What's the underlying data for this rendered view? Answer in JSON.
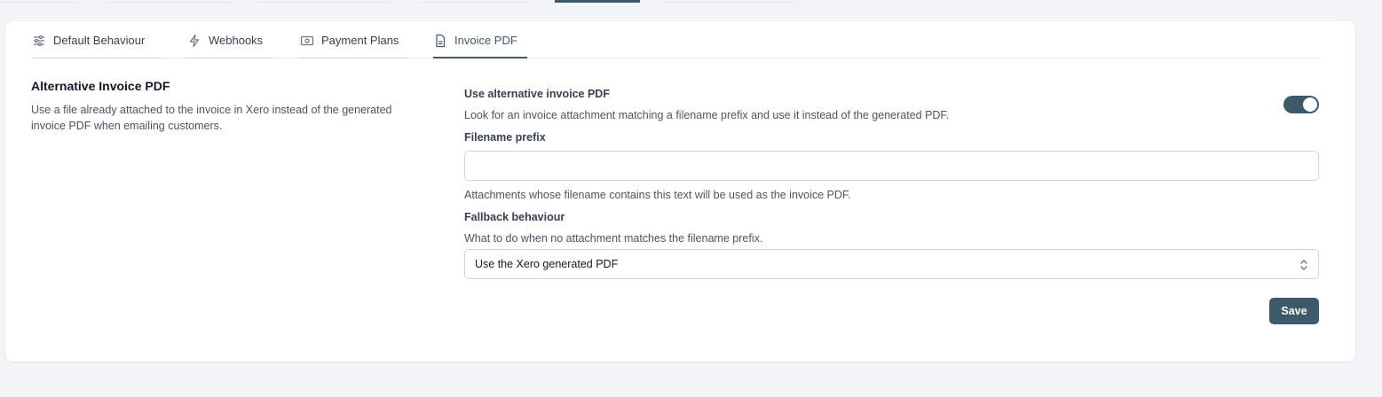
{
  "tabs": [
    {
      "label": "Default Behaviour",
      "icon": "sliders-icon"
    },
    {
      "label": "Webhooks",
      "icon": "lightning-icon"
    },
    {
      "label": "Payment Plans",
      "icon": "cash-icon"
    },
    {
      "label": "Invoice PDF",
      "icon": "document-icon",
      "active": true
    }
  ],
  "section": {
    "title": "Alternative Invoice PDF",
    "description": "Use a file already attached to the invoice in Xero instead of the generated invoice PDF when emailing customers."
  },
  "use_alt": {
    "label": "Use alternative invoice PDF",
    "help": "Look for an invoice attachment matching a filename prefix and use it instead of the generated PDF.",
    "enabled": true
  },
  "filename_prefix": {
    "label": "Filename prefix",
    "value": "",
    "help": "Attachments whose filename contains this text will be used as the invoice PDF."
  },
  "fallback": {
    "label": "Fallback behaviour",
    "help": "What to do when no attachment matches the filename prefix.",
    "selected": "Use the Xero generated PDF"
  },
  "actions": {
    "save_label": "Save"
  },
  "colors": {
    "accent": "#3d5a6b",
    "background": "#f3f4f6"
  }
}
